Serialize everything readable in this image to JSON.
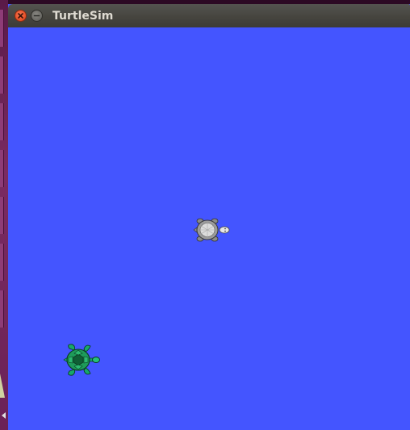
{
  "window": {
    "title": "TurtleSim",
    "close_icon": "close-icon",
    "minimize_icon": "minimize-icon"
  },
  "canvas": {
    "background_color": "#4455ff"
  },
  "turtles": [
    {
      "name": "turtle-gray",
      "icon": "turtle-icon",
      "color": "#c8c8c8",
      "heading": "east"
    },
    {
      "name": "turtle-green",
      "icon": "turtle-icon",
      "color": "#1fa85a",
      "heading": "east"
    }
  ],
  "launcher": {
    "accent": "#7a2b62"
  }
}
